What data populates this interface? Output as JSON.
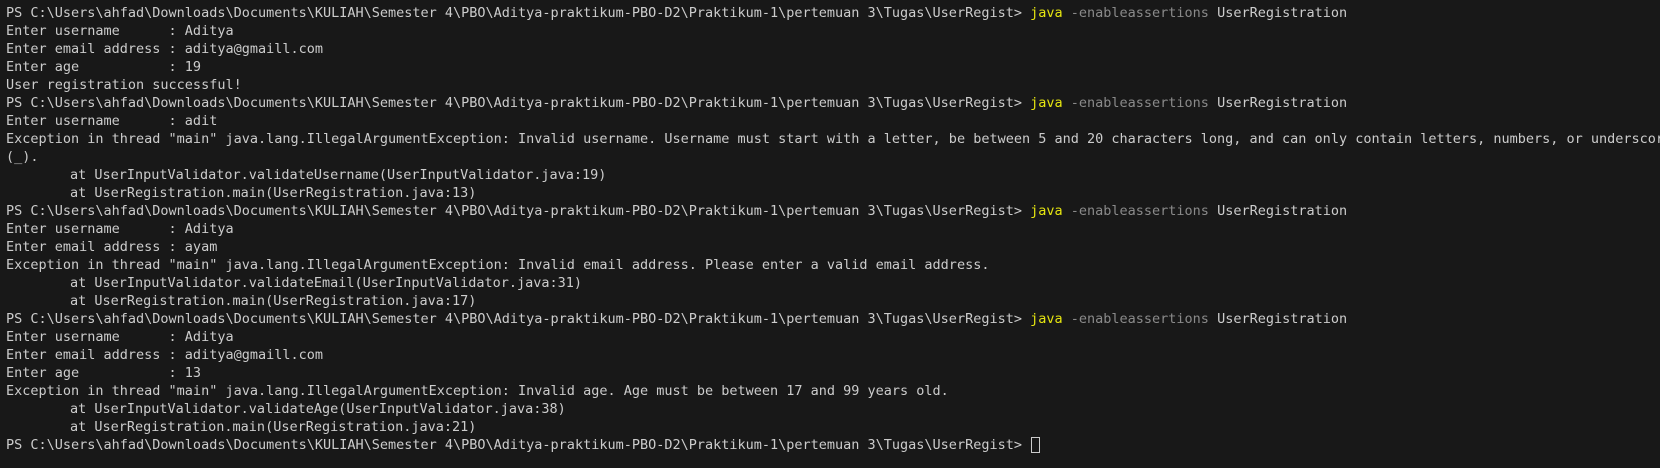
{
  "prompt": "PS C:\\Users\\ahfad\\Downloads\\Documents\\KULIAH\\Semester 4\\PBO\\Aditya-praktikum-PBO-D2\\Praktikum-1\\pertemuan 3\\Tugas\\UserRegist> ",
  "command": {
    "exe": "java",
    "flag": "-enableassertions",
    "arg": "UserRegistration"
  },
  "runs": [
    {
      "lines": [
        "Enter username      : Aditya",
        "Enter email address : aditya@gmaill.com",
        "Enter age           : 19",
        "User registration successful!"
      ]
    },
    {
      "lines": [
        "Enter username      : adit",
        "Exception in thread \"main\" java.lang.IllegalArgumentException: Invalid username. Username must start with a letter, be between 5 and 20 characters long, and can only contain letters, numbers, or underscore",
        "(_)."
      ],
      "trace": [
        "at UserInputValidator.validateUsername(UserInputValidator.java:19)",
        "at UserRegistration.main(UserRegistration.java:13)"
      ]
    },
    {
      "lines": [
        "Enter username      : Aditya",
        "Enter email address : ayam",
        "Exception in thread \"main\" java.lang.IllegalArgumentException: Invalid email address. Please enter a valid email address."
      ],
      "trace": [
        "at UserInputValidator.validateEmail(UserInputValidator.java:31)",
        "at UserRegistration.main(UserRegistration.java:17)"
      ]
    },
    {
      "lines": [
        "Enter username      : Aditya",
        "Enter email address : aditya@gmaill.com",
        "Enter age           : 13",
        "Exception in thread \"main\" java.lang.IllegalArgumentException: Invalid age. Age must be between 17 and 99 years old."
      ],
      "trace": [
        "at UserInputValidator.validateAge(UserInputValidator.java:38)",
        "at UserRegistration.main(UserRegistration.java:21)"
      ]
    }
  ],
  "colors": {
    "background": "#181818",
    "text": "#cccccc",
    "java": "#e5e510",
    "flag": "#8a8a8a"
  },
  "icons": {
    "cursor": "cursor-block-icon"
  }
}
